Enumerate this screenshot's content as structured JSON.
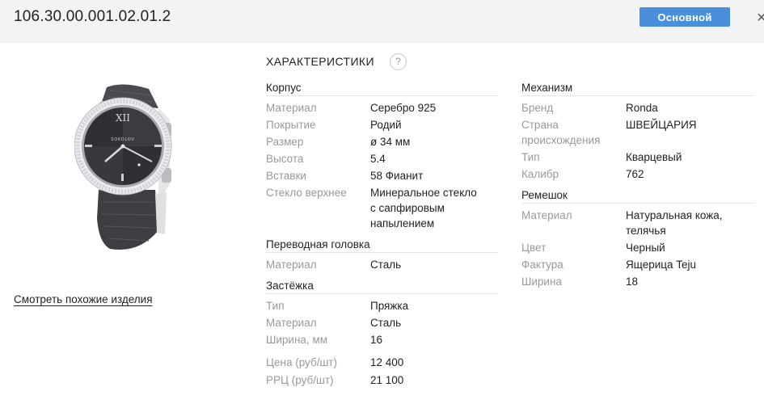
{
  "header": {
    "sku": "106.30.00.001.02.01.2",
    "main_button": "Основной",
    "close": "×"
  },
  "product": {
    "brand_on_dial": "SOKOLOV",
    "similar_link": "Смотреть похожие изделия"
  },
  "characteristics": {
    "title": "ХАРАКТЕРИСТИКИ",
    "help": "?",
    "case": {
      "title": "Корпус",
      "rows": [
        {
          "label": "Материал",
          "value": "Серебро 925"
        },
        {
          "label": "Покрытие",
          "value": "Родий"
        },
        {
          "label": "Размер",
          "value": "ø 34 мм"
        },
        {
          "label": "Высота",
          "value": "5.4"
        },
        {
          "label": "Вставки",
          "value": "58 Фианит"
        },
        {
          "label": "Стекло верхнее",
          "value_lines": [
            "Минеральное стекло",
            "с сапфировым",
            "напылением"
          ]
        }
      ]
    },
    "crown": {
      "title": "Переводная головка",
      "rows": [
        {
          "label": "Материал",
          "value": "Сталь"
        }
      ]
    },
    "clasp": {
      "title": "Застёжка",
      "rows": [
        {
          "label": "Тип",
          "value": "Пряжка"
        },
        {
          "label": "Материал",
          "value": "Сталь"
        },
        {
          "label": "Ширина, мм",
          "value": "16"
        }
      ]
    },
    "prices": [
      {
        "label": "Цена (руб/шт)",
        "value": "12 400"
      },
      {
        "label": "РРЦ (руб/шт)",
        "value": "21 100"
      }
    ],
    "mechanism": {
      "title": "Механизм",
      "rows": [
        {
          "label": "Бренд",
          "value": "Ronda"
        },
        {
          "label_lines": [
            "Страна",
            "происхождения"
          ],
          "value": "ШВЕЙЦАРИЯ"
        },
        {
          "label": "Тип",
          "value": "Кварцевый"
        },
        {
          "label": "Калибр",
          "value": "762"
        }
      ]
    },
    "strap": {
      "title": "Ремешок",
      "rows": [
        {
          "label": "Материал",
          "value_lines": [
            "Натуральная кожа,",
            "телячья"
          ]
        },
        {
          "label": "Цвет",
          "value": "Черный"
        },
        {
          "label": "Фактура",
          "value": "Ящерица Teju"
        },
        {
          "label": "Ширина",
          "value": "18"
        }
      ]
    }
  }
}
